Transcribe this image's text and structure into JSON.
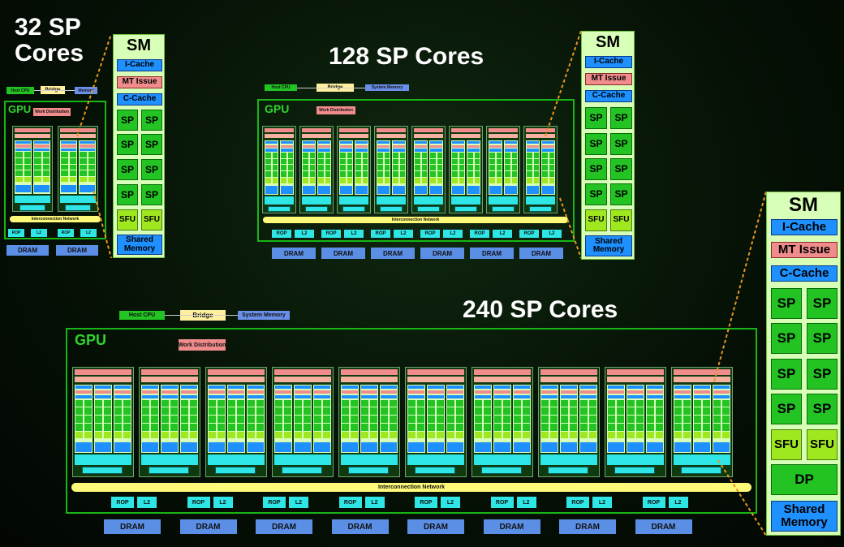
{
  "titles": {
    "t32": "32 SP Cores",
    "t32_line1": "32 SP",
    "t32_line2": "Cores",
    "t128": "128 SP Cores",
    "t240": "240 SP Cores"
  },
  "common": {
    "host_cpu": "Host CPU",
    "bridge": "Bridge",
    "memory": "Memory",
    "system_memory": "System Memory",
    "gpu": "GPU",
    "work_distribution": "Work Distribution",
    "interconnection_network": "Interconnection Network",
    "rop": "ROP",
    "l2": "L2",
    "dram": "DRAM"
  },
  "sm": {
    "title": "SM",
    "icache": "I-Cache",
    "mt_issue": "MT Issue",
    "ccache": "C-Cache",
    "sp": "SP",
    "sfu": "SFU",
    "dp": "DP",
    "shared_memory": "Shared Memory",
    "shared_line1": "Shared",
    "shared_line2": "Memory"
  },
  "colors": {
    "gpu_border": "#17b517",
    "sp_green": "#22c322",
    "sfu_lime": "#9fe81f",
    "cache_blue": "#1e90ff",
    "issue_pink": "#f08c8c",
    "bridge_yellow": "#fff0a0",
    "dram_blue": "#5b8fe6",
    "rop_cyan": "#2ee6e6",
    "dashed_orange": "#e69520"
  },
  "icons": []
}
